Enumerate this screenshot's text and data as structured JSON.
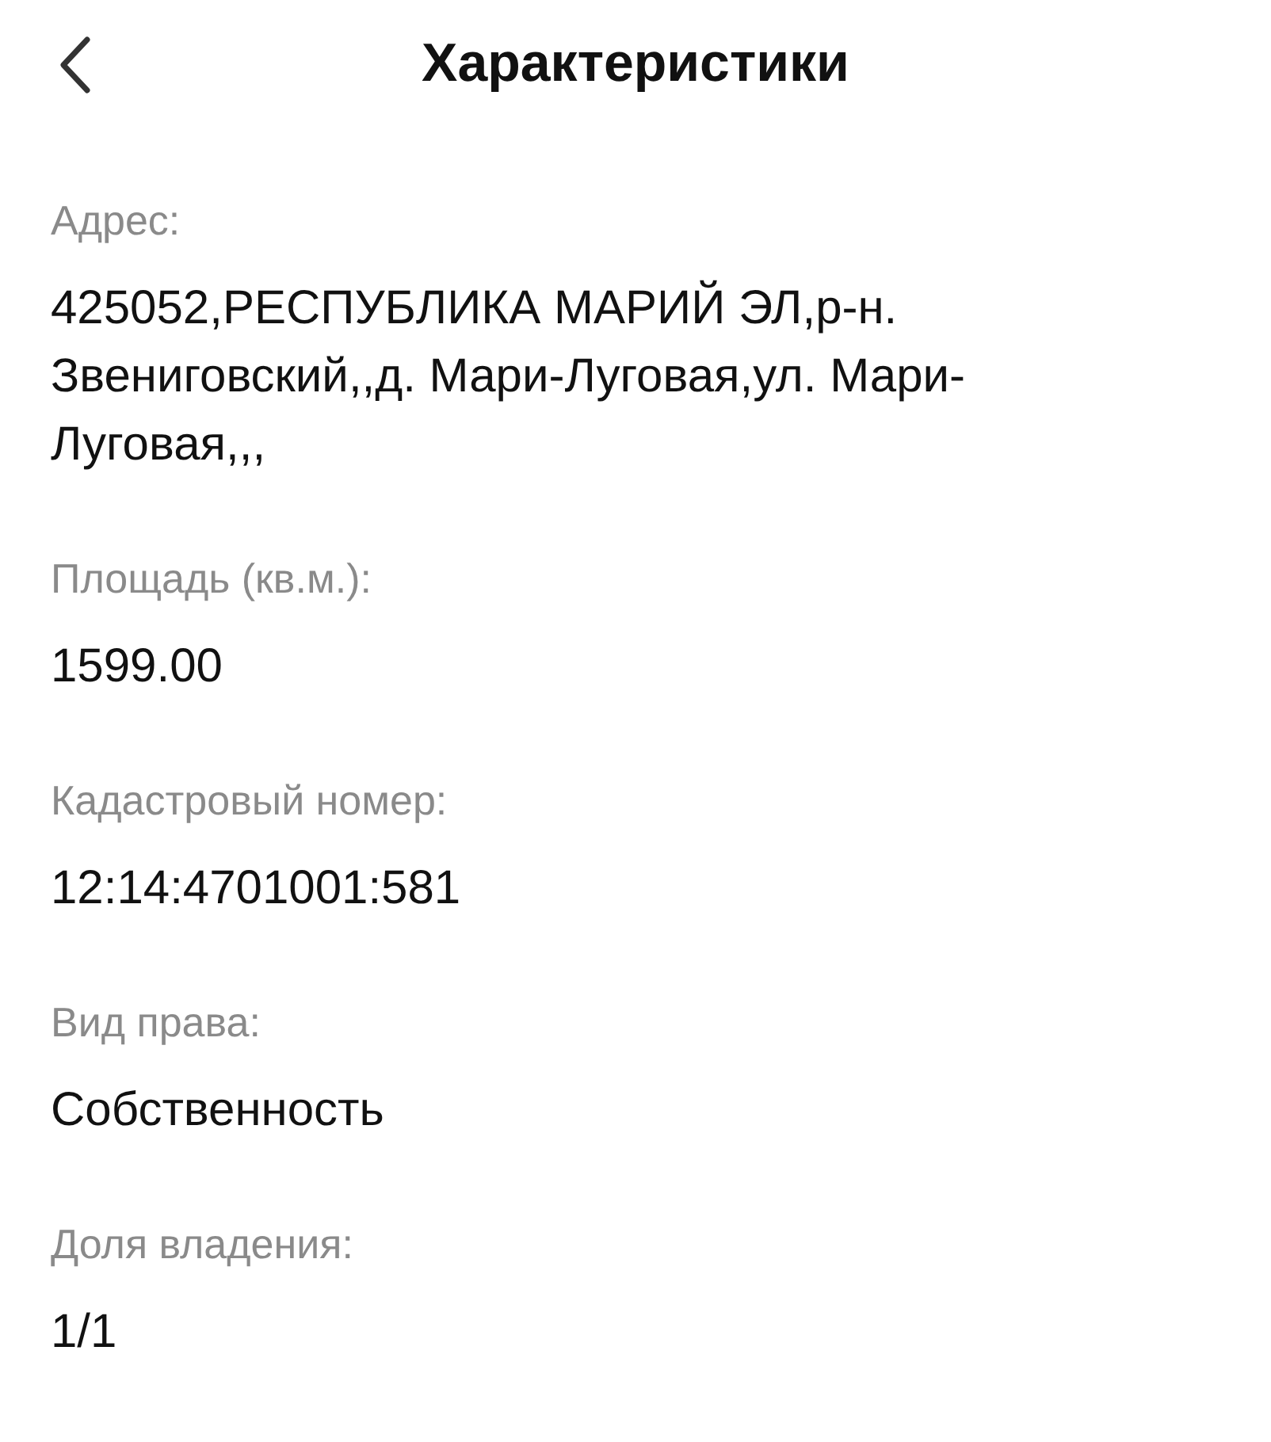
{
  "header": {
    "title": "Характеристики"
  },
  "fields": [
    {
      "label": "Адрес:",
      "value": "425052,РЕСПУБЛИКА МАРИЙ ЭЛ,р-н. Звениговский,,д. Мари-Луговая,ул. Мари-Луговая,,,"
    },
    {
      "label": "Площадь (кв.м.):",
      "value": "1599.00"
    },
    {
      "label": "Кадастровый номер:",
      "value": "12:14:4701001:581"
    },
    {
      "label": "Вид права:",
      "value": "Собственность"
    },
    {
      "label": "Доля владения:",
      "value": "1/1"
    }
  ]
}
